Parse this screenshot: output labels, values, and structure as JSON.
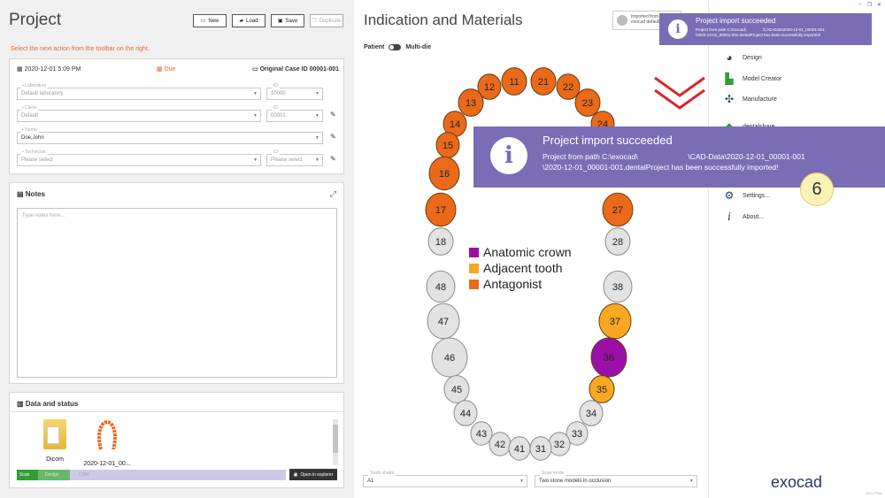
{
  "project": {
    "title": "Project",
    "toolbar": {
      "new": "New",
      "load": "Load",
      "save": "Save",
      "duplicate": "Duplicate"
    },
    "hint": "Select the next action from the toolbar on the right.",
    "date": "2020-12-01 5:09 PM",
    "due": "Due",
    "case_id": "Original Case ID 00001-001",
    "laboratory": {
      "label": "Laboratory",
      "value": "Default laboratory",
      "id_label": "ID",
      "id_value": "10000"
    },
    "client": {
      "label": "Client",
      "value": "Default",
      "id_label": "ID",
      "id_value": "00001"
    },
    "patient": {
      "label": "Name",
      "value": "Doe,John"
    },
    "technician": {
      "label": "Technician",
      "value": "Please select",
      "id_label": "ID",
      "id_value": "Please select"
    },
    "notes": {
      "title": "Notes",
      "placeholder": "Type notes here..."
    },
    "data_status": {
      "title": "Data and status",
      "files": [
        {
          "name": "Dicom",
          "icon": "folder-icon"
        },
        {
          "name": "2020-12-01_00...",
          "icon": "dental-arch-icon"
        }
      ],
      "steps": [
        "Scan",
        "Design",
        "CAM"
      ],
      "open_explorer": "Open in explorer"
    }
  },
  "indication": {
    "title": "Indication and Materials",
    "toggle_left": "Patient",
    "toggle_right": "Multi-die",
    "imported_label": "Imported from",
    "imported_value": "exocad default",
    "legend": [
      {
        "label": "Anatomic crown",
        "color": "#9b0fa8"
      },
      {
        "label": "Adjacent tooth",
        "color": "#f7a823"
      },
      {
        "label": "Antagonist",
        "color": "#ea6a1a"
      }
    ],
    "teeth": [
      {
        "n": "11",
        "c": "orange"
      },
      {
        "n": "12",
        "c": "orange"
      },
      {
        "n": "13",
        "c": "orange"
      },
      {
        "n": "14",
        "c": "orange"
      },
      {
        "n": "15",
        "c": "orange"
      },
      {
        "n": "16",
        "c": "orange"
      },
      {
        "n": "17",
        "c": "orange"
      },
      {
        "n": "18",
        "c": "gray"
      },
      {
        "n": "21",
        "c": "orange"
      },
      {
        "n": "22",
        "c": "orange"
      },
      {
        "n": "23",
        "c": "orange"
      },
      {
        "n": "24",
        "c": "orange"
      },
      {
        "n": "27",
        "c": "orange"
      },
      {
        "n": "28",
        "c": "gray"
      },
      {
        "n": "48",
        "c": "gray"
      },
      {
        "n": "47",
        "c": "gray"
      },
      {
        "n": "46",
        "c": "gray"
      },
      {
        "n": "45",
        "c": "gray"
      },
      {
        "n": "44",
        "c": "gray"
      },
      {
        "n": "43",
        "c": "gray"
      },
      {
        "n": "42",
        "c": "gray"
      },
      {
        "n": "41",
        "c": "gray"
      },
      {
        "n": "38",
        "c": "gray"
      },
      {
        "n": "37",
        "c": "yellow"
      },
      {
        "n": "36",
        "c": "purple"
      },
      {
        "n": "35",
        "c": "yellow"
      },
      {
        "n": "34",
        "c": "gray"
      },
      {
        "n": "33",
        "c": "gray"
      },
      {
        "n": "32",
        "c": "gray"
      },
      {
        "n": "31",
        "c": "gray"
      }
    ],
    "colors": {
      "orange": "#ea6a1a",
      "yellow": "#f7a823",
      "purple": "#9b0fa8",
      "gray": "#e2e2e2"
    },
    "tooth_shade": {
      "label": "Tooth shade",
      "value": "A1"
    },
    "scan_mode": {
      "label": "Scan mode",
      "value": "Two stone models in occlusion"
    }
  },
  "menu": {
    "items": [
      {
        "label": "Design",
        "icon": "design-icon"
      },
      {
        "label": "Model Creator",
        "icon": "model-creator-icon"
      },
      {
        "label": "Manufacture",
        "icon": "manufacture-icon"
      },
      {
        "label": "dentalshare",
        "icon": "dentalshare-icon"
      },
      {
        "label": "Settings...",
        "icon": "gear-icon"
      },
      {
        "label": "About...",
        "icon": "info-icon"
      }
    ],
    "brand": "exocad",
    "version": "v3.0-7734"
  },
  "toast_small": {
    "title": "Project import succeeded",
    "line1": "Project from path C:\\exocad\\               \\CAD-Data\\2020-12-01_00001-001",
    "line2": "\\2020-12-01_00001-001.dentalProject has been successfully imported!"
  },
  "toast_big": {
    "title": "Project import succeeded",
    "line1": "Project from path C:\\exocad\\                        \\CAD-Data\\2020-12-01_00001-001",
    "line2": "\\2020-12-01_00001-001.dentalProject has been successfully imported!"
  },
  "step_badge": "6",
  "window_controls": {
    "minimize": "–",
    "restore": "❐",
    "close": "✕"
  }
}
